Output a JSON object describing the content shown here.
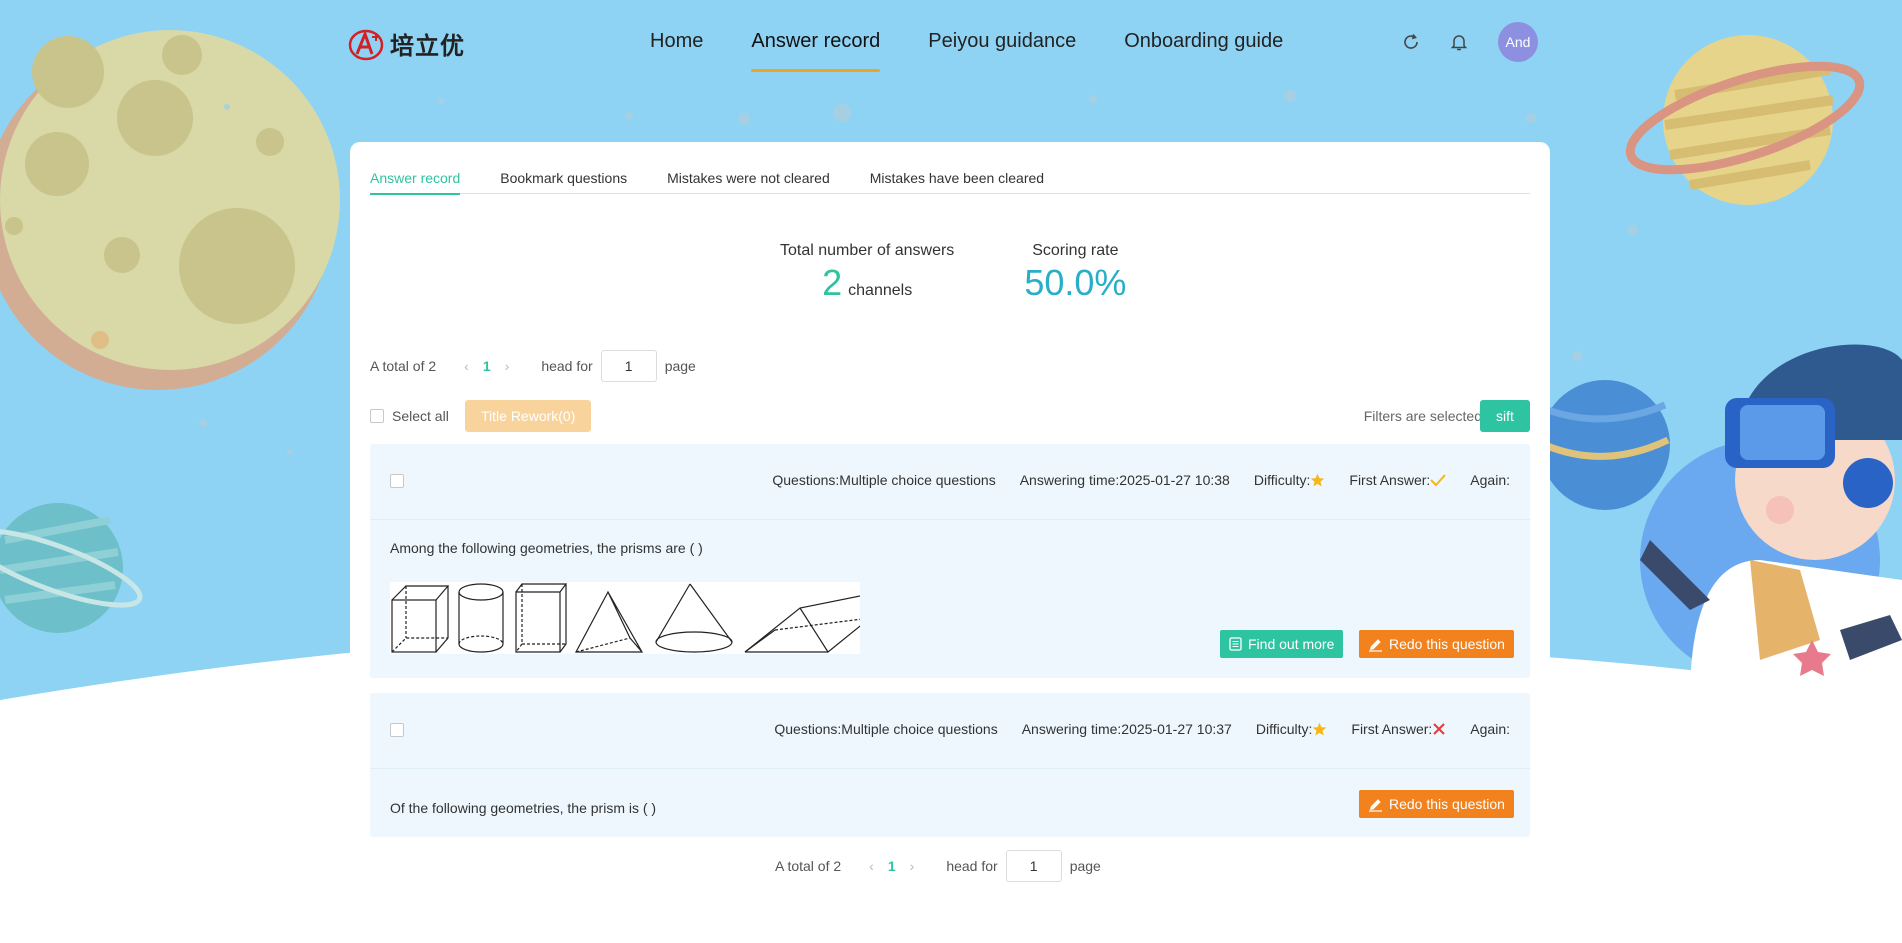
{
  "brand": {
    "logo_text": "培立优"
  },
  "nav": {
    "items": [
      {
        "label": "Home"
      },
      {
        "label": "Answer record"
      },
      {
        "label": "Peiyou guidance"
      },
      {
        "label": "Onboarding guide"
      }
    ],
    "active_index": 1,
    "active_color": "#f1a31e"
  },
  "user": {
    "avatar_text": "And"
  },
  "tabs": {
    "items": [
      {
        "label": "Answer record"
      },
      {
        "label": "Bookmark questions"
      },
      {
        "label": "Mistakes were not cleared"
      },
      {
        "label": "Mistakes have been cleared"
      }
    ],
    "active_index": 0
  },
  "stats": {
    "total_label": "Total number of answers",
    "total_value": "2",
    "total_unit": "channels",
    "rate_label": "Scoring rate",
    "rate_value": "50.0%"
  },
  "pagination": {
    "total_text": "A total of 2",
    "current_page": "1",
    "goto_label": "head for",
    "goto_value": "1",
    "page_suffix": "page"
  },
  "actions": {
    "select_all_label": "Select all",
    "rework_label": "Title Rework(0)",
    "filters_label": "Filters are selected",
    "sift_label": "sift"
  },
  "questions": [
    {
      "type_text": "Questions:Multiple choice questions",
      "time_text": "Answering time:2025-01-27 10:38",
      "difficulty_label": "Difficulty:",
      "first_answer_label": "First Answer:",
      "first_answer_icon": "check-icon",
      "again_label": "Again:",
      "text": "Among the following geometries, the prisms are ( )",
      "find_out_more_label": "Find out more",
      "redo_label": "Redo this question"
    },
    {
      "type_text": "Questions:Multiple choice questions",
      "time_text": "Answering time:2025-01-27 10:37",
      "difficulty_label": "Difficulty:",
      "first_answer_label": "First Answer:",
      "first_answer_icon": "cross-icon",
      "again_label": "Again:",
      "text": "Of the following geometries, the prism is ( )",
      "redo_label": "Redo this question"
    }
  ],
  "colors": {
    "accent": "#2ec4a1",
    "rate": "#29aec9",
    "redo": "#f1821e",
    "sky": "#8fd3f4"
  }
}
